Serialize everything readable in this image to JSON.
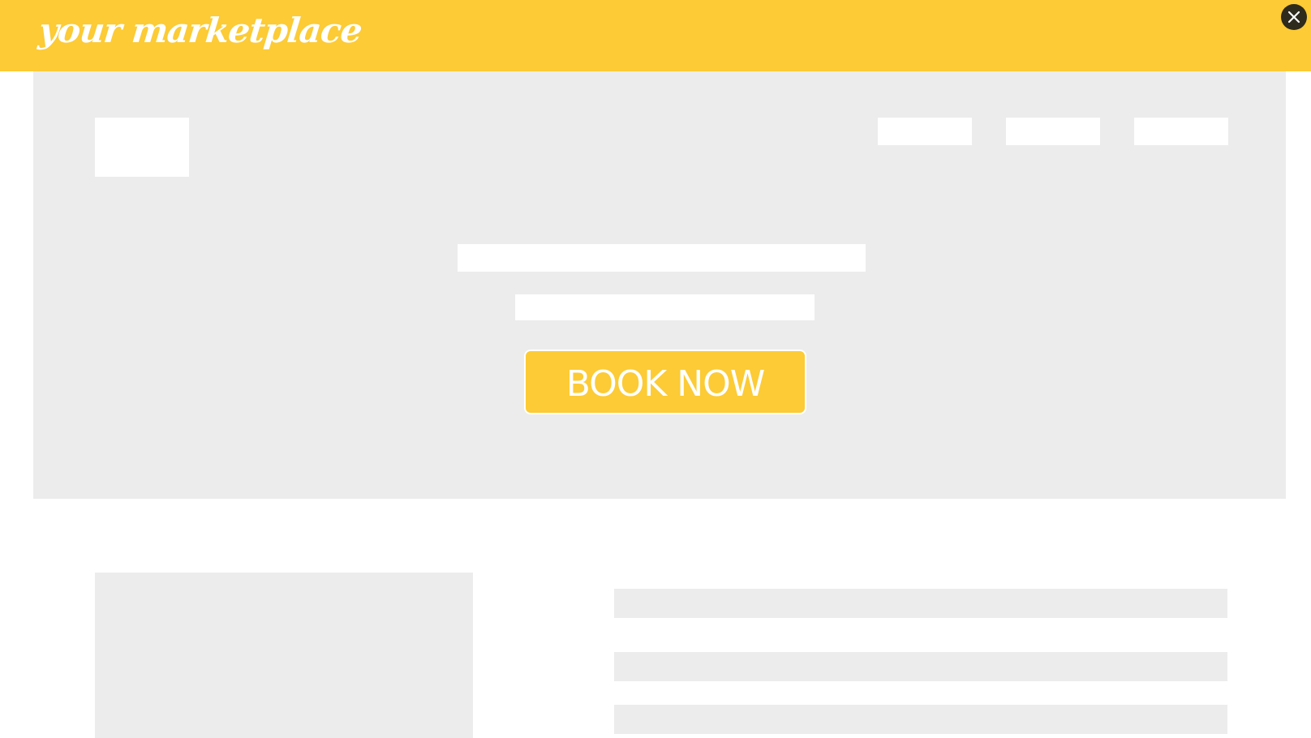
{
  "brand": {
    "name": "your marketplace",
    "bar_color": "#fccb35",
    "text_color": "#ffffff"
  },
  "close_button": {
    "icon": "close-icon",
    "color": "#2e2a1c"
  },
  "hero": {
    "background": "#ececec",
    "placeholder_color": "#ffffff",
    "cta_label": "BOOK NOW",
    "cta_color": "#fccb35",
    "nav_placeholders": 3
  },
  "content": {
    "placeholder_color": "#ececec",
    "text_line_placeholders": 3
  }
}
